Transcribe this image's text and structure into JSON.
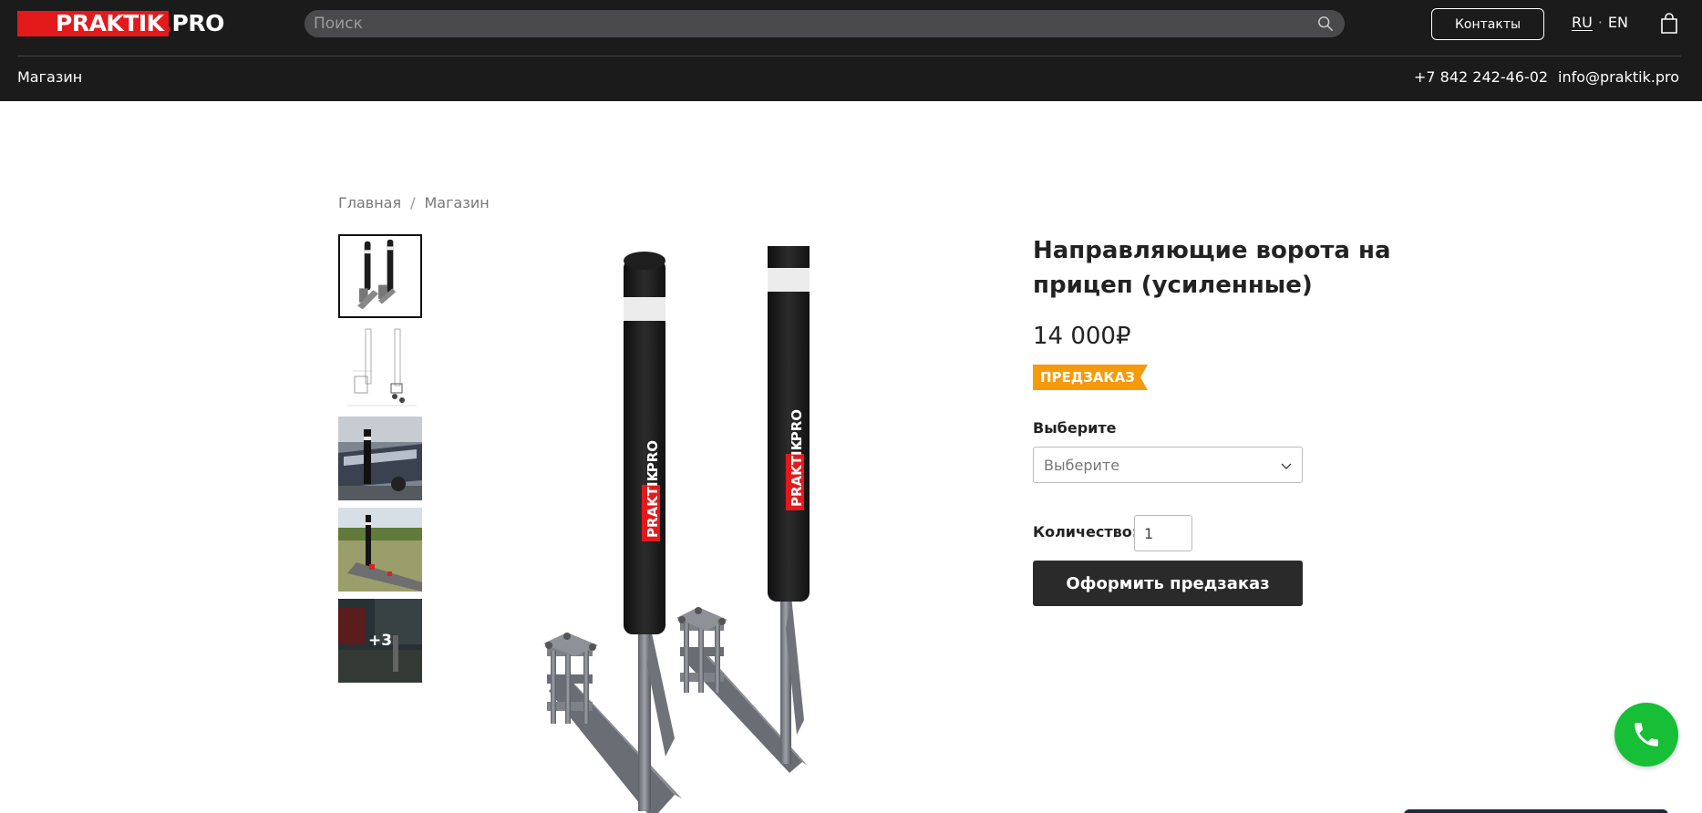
{
  "header": {
    "logo": {
      "part1": "PRAKTIK",
      "dot": ".",
      "part2": "PRO"
    },
    "search_placeholder": "Поиск",
    "contacts_label": "Контакты",
    "lang": {
      "ru": "RU",
      "separator": "·",
      "en": "EN"
    },
    "nav_shop": "Магазин",
    "phone": "+7 842 242-46-02",
    "email": "info@praktik.pro"
  },
  "breadcrumb": {
    "items": [
      "Главная",
      "Магазин"
    ],
    "separator": "/"
  },
  "gallery": {
    "more_label": "+3"
  },
  "product": {
    "title": "Направляющие ворота на прицеп (усиленные)",
    "price": "14 000₽",
    "badge": "ПРЕДЗАКАЗ",
    "select_label": "Выберите",
    "select_value": "Выберите",
    "qty_label": "Количество:",
    "qty_value": "1",
    "order_label": "Оформить предзаказ"
  },
  "colors": {
    "header_bg": "#1b1b1c",
    "brand_red": "#e3191c",
    "badge_orange": "#f59a0b",
    "call_green": "#17bf36",
    "button_dark": "#2a2a2a"
  }
}
